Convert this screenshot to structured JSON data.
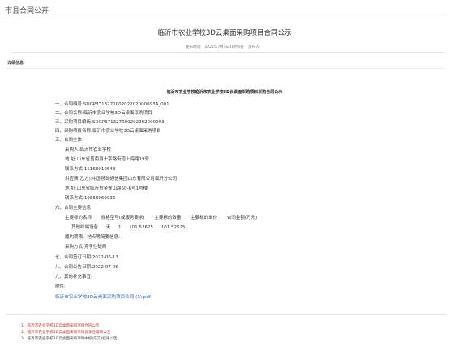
{
  "header": {
    "section_title": "市县合同公开"
  },
  "notice": {
    "title": "临沂市农业学校3D云桌面采购项目合同公示",
    "publish_label": "发布时间:",
    "publish_time": "2022年7月6日16时6分",
    "publisher_label": "发布人:",
    "publisher": ""
  },
  "detail": {
    "label": "详细信息"
  },
  "document": {
    "title": "临沂市农业学校临沂市农业学校3D云桌面采购项目采购合同公示",
    "lines": {
      "contract_no": "一、合同编号:SDGP371327000202202000093A_001",
      "contract_name": "二、合同名称:临沂市农业学校3D云桌面采购项目",
      "project_no": "三、采购项目编码:SDGP371327000202202000093",
      "project_name": "四、采购项目名称:临沂市农业学校3D云桌面采购项目",
      "subject_heading": "五、合同主体",
      "buyer": "采购人:临沂市农业学校",
      "buyer_address": "地    址:山东省莒南县十字路街道上海路19号",
      "buyer_contact": "联系方式:15168910548",
      "supplier": "供应商(乙方):中国移动通信集团山东有限公司临沂分公司",
      "supplier_address": "地    址:山东省临沂市金雀山路50-6号1号楼",
      "supplier_contact": "联系方式:19853969936",
      "main_info_heading": "六、合同主要信息",
      "columns": [
        "主要标的名称",
        "规格型号(或服务要求)",
        "主要标的数量",
        "主要标的单价",
        "合同金额(万元)"
      ],
      "row": [
        "其他终端设备",
        "无",
        "1",
        "101.52625",
        "101.52625"
      ],
      "performance": "履约期限、地点等简要信息:",
      "procurement_method": "采购方式:竞争性磋商",
      "sign_date": "七、合同签订日期:2022-06-13",
      "announce_date": "八、合同公告日期:2022-07-06",
      "other": "九、其他补充事宜:",
      "attachment_label": "附件:"
    },
    "attachment": "临沂市农业学校3D云桌面采购项目合同 (3).pdf"
  },
  "related": [
    "1、临沂市农业学校3D云桌面采购项目合同公示",
    "2、临沂市农业学校3D云桌面采购项目竞争性磋商公告",
    "3、临沂市农业学校3D云桌面采购项目中标(成交)结果公告"
  ],
  "colors": {
    "link": "#2a5fb0",
    "related_red": "#c0392b"
  }
}
